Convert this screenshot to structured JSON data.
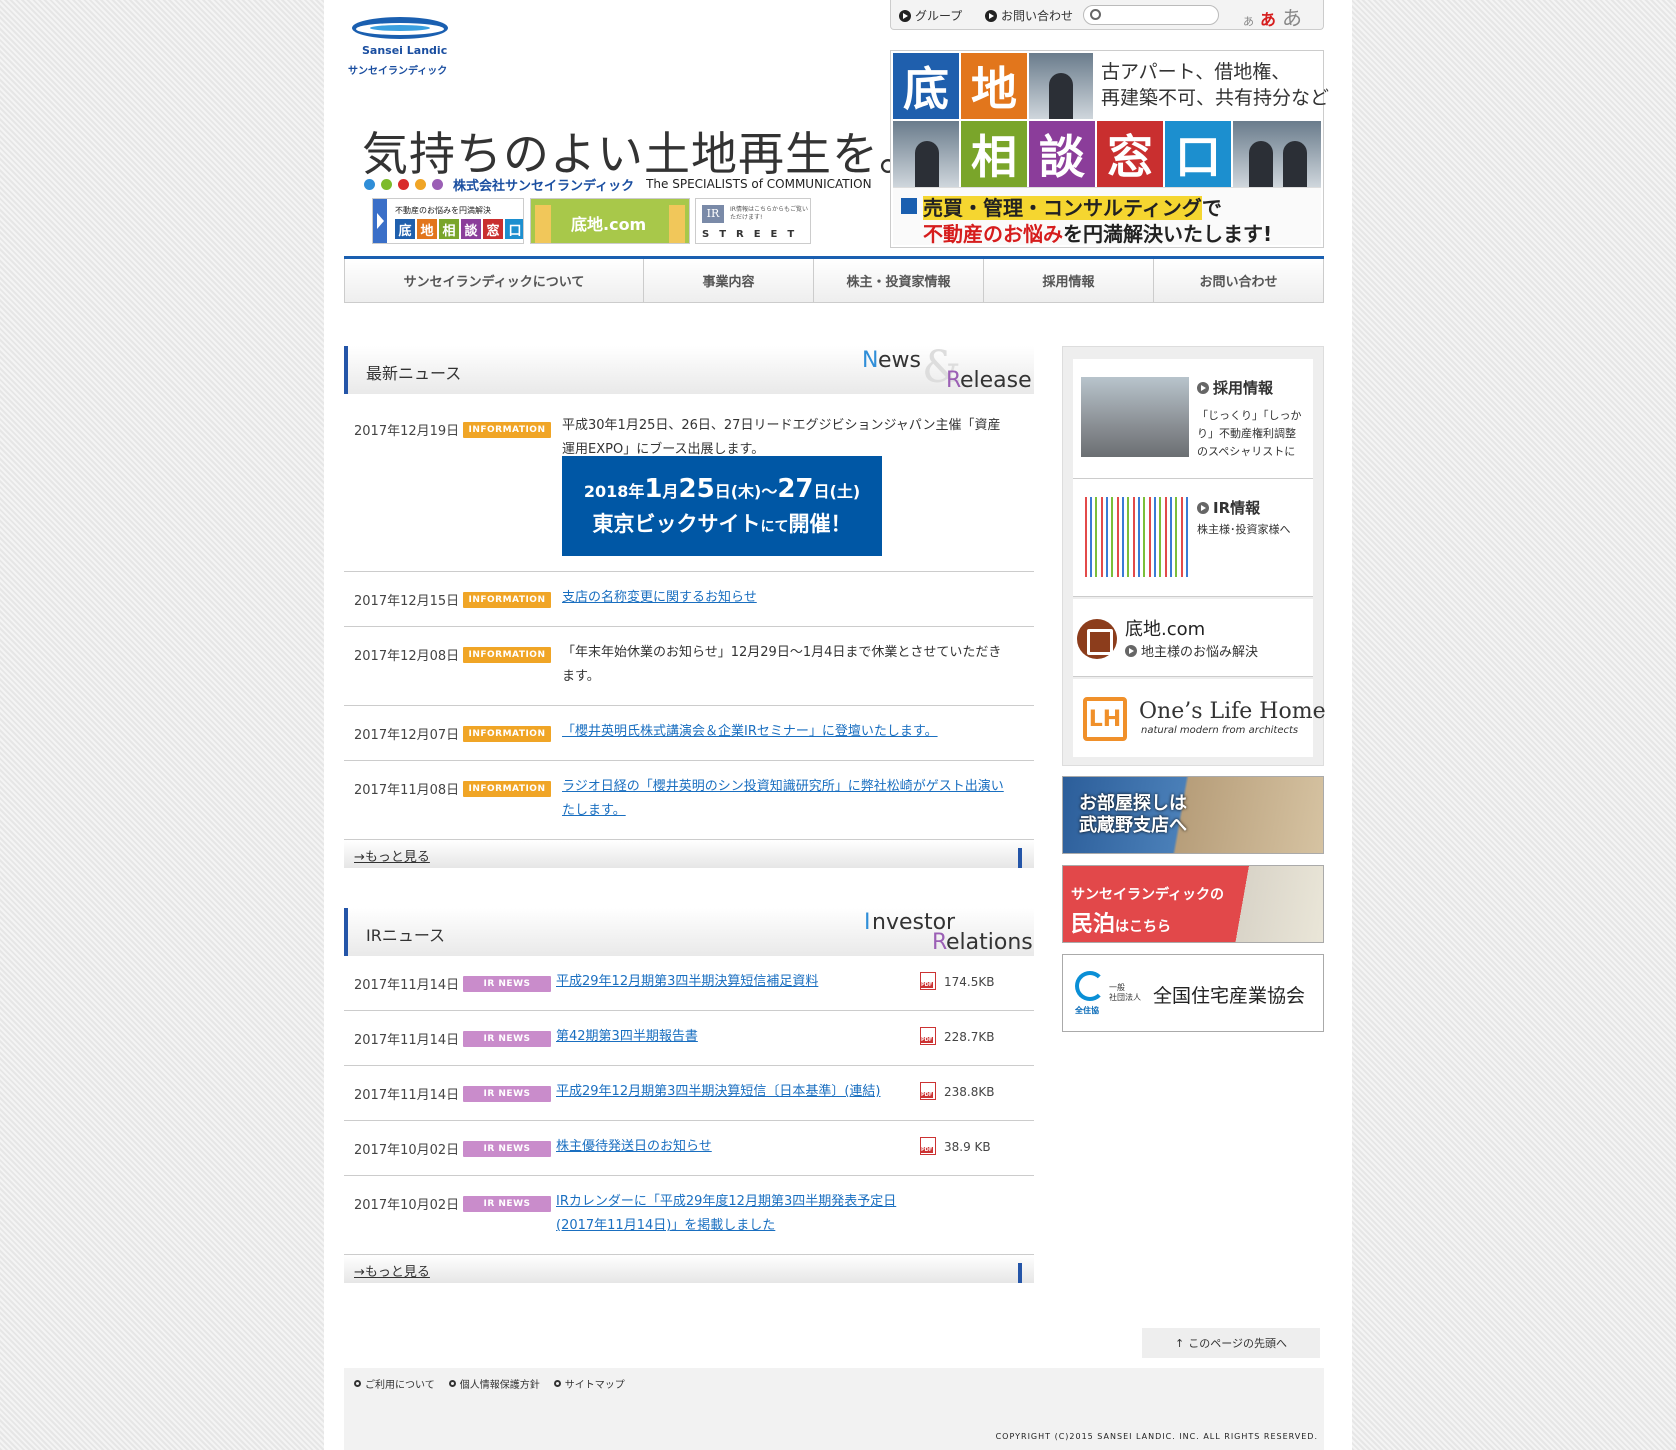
{
  "header": {
    "logo_name": "Sansei Landic",
    "logo_kana": "サンセイランディック",
    "tagline": "気持ちのよい土地再生を。",
    "company_name": "株式会社サンセイランディック",
    "company_slogan": "The SPECIALISTS of COMMUNICATION",
    "dot_colors": [
      "#2f8ed8",
      "#7dbb2b",
      "#d92b2b",
      "#f0a526",
      "#9b5fb5"
    ],
    "banners": {
      "soudan_caption": "不動産のお悩みを円満解決",
      "soudan_tiles": [
        "底",
        "地",
        "相",
        "談",
        "窓",
        "口"
      ],
      "sokochi": "底地.com",
      "ir_label": "IR",
      "ir_note": "IR情報はこちらからもご覧いただけます!",
      "street": "STREET"
    }
  },
  "utility": {
    "group": "グループ",
    "contact": "お問い合わせ",
    "search_placeholder": "",
    "font_small": "あ",
    "font_medium": "あ",
    "font_large": "あ"
  },
  "hero": {
    "tiles": [
      "底",
      "地",
      "相",
      "談",
      "窓",
      "口"
    ],
    "tile_colors": [
      "#1f5fad",
      "#e2761c",
      "#7aa52a",
      "#8b3d9a",
      "#c92f2f",
      "#1c8fcf"
    ],
    "text_line1": "古アパート、借地権、",
    "text_line2": "再建築不可、共有持分など",
    "bottom_line1_highlight": "売買・管理・コンサルティング",
    "bottom_line1_rest": "で",
    "bottom_line2_red": "不動産のお悩み",
    "bottom_line2_rest": "を円満解決いたします!"
  },
  "nav": {
    "items": [
      {
        "label": "サンセイランディックについて"
      },
      {
        "label": "事業内容"
      },
      {
        "label": "株主・投資家情報"
      },
      {
        "label": "採用情報"
      },
      {
        "label": "お問い合わせ"
      }
    ]
  },
  "news": {
    "title": "最新ニュース",
    "deco_word1": "ews",
    "deco_cap1": "N",
    "deco_word2": "elease",
    "deco_cap2": "R",
    "deco_amp": "&",
    "badge": "INFORMATION",
    "items": [
      {
        "date": "2017年12月19日",
        "text": "平成30年1月25日、26日、27日リードエグジビションジャパン主催「資産運用EXPO」にブース出展します。"
      },
      {
        "date": "2017年12月15日",
        "text": "支店の名称変更に関するお知らせ"
      },
      {
        "date": "2017年12月08日",
        "text": "「年末年始休業のお知らせ」12月29日～1月4日まで休業とさせていただきます。"
      },
      {
        "date": "2017年12月07日",
        "text": "「櫻井英明氏株式講演会＆企業IRセミナー」に登壇いたします。"
      },
      {
        "date": "2017年11月08日",
        "text": "ラジオ日経の「櫻井英明のシン投資知識研究所」に弊社松崎がゲスト出演いたします。"
      }
    ],
    "expo": {
      "year": "2018年",
      "d1": "1",
      "m": "月",
      "d2": "25",
      "w1": "日(木)～",
      "d3": "27",
      "w2": "日(土)",
      "venue": "東京ビックサイト",
      "venue_suffix": "にて",
      "held": "開催！"
    },
    "more": "→もっと見る"
  },
  "ir": {
    "title": "IRニュース",
    "deco_cap1": "I",
    "deco_word1": "nvestor",
    "deco_cap2": "R",
    "deco_word2": "elations",
    "badge": "IR NEWS",
    "items": [
      {
        "date": "2017年11月14日",
        "text": "平成29年12月期第3四半期決算短信補足資料",
        "size": "174.5KB"
      },
      {
        "date": "2017年11月14日",
        "text": "第42期第3四半期報告書",
        "size": "228.7KB"
      },
      {
        "date": "2017年11月14日",
        "text": "平成29年12月期第3四半期決算短信〔日本基準〕(連結)",
        "size": "238.8KB"
      },
      {
        "date": "2017年10月02日",
        "text": "株主優待発送日のお知らせ",
        "size": "38.9 KB"
      },
      {
        "date": "2017年10月02日",
        "text": "IRカレンダーに「平成29年度12月期第3四半期発表予定日(2017年11月14日)」を掲載しました",
        "size": ""
      }
    ],
    "more": "→もっと見る"
  },
  "sidebar": {
    "recruit_title": "採用情報",
    "recruit_desc": "「じっくり」「しっかり」不動産権利調整のスペシャリストに",
    "ir_title": "IR情報",
    "ir_desc": "株主様･投資家様へ",
    "sokochi_name": "底地.com",
    "sokochi_sub": "地主様のお悩み解決",
    "olh_mark": "LH",
    "olh_name": "One’s Life Home",
    "olh_sub": "natural modern from architects",
    "banner1_line1": "お部屋探しは",
    "banner1_line2": "武蔵野支店へ",
    "banner2_line1": "サンセイランディックの",
    "banner2_main": "民泊",
    "banner2_rest": "はこちら",
    "assoc_mark": "全住協",
    "assoc_small1": "一般",
    "assoc_small2": "社団法人",
    "assoc_name": "全国住宅産業協会"
  },
  "footer": {
    "pagetop": "このページの先頭へ",
    "links": [
      "ご利用について",
      "個人情報保護方針",
      "サイトマップ"
    ],
    "copyright": "COPYRIGHT (C)2015 SANSEI LANDIC. INC. ALL RIGHTS RESERVED."
  }
}
